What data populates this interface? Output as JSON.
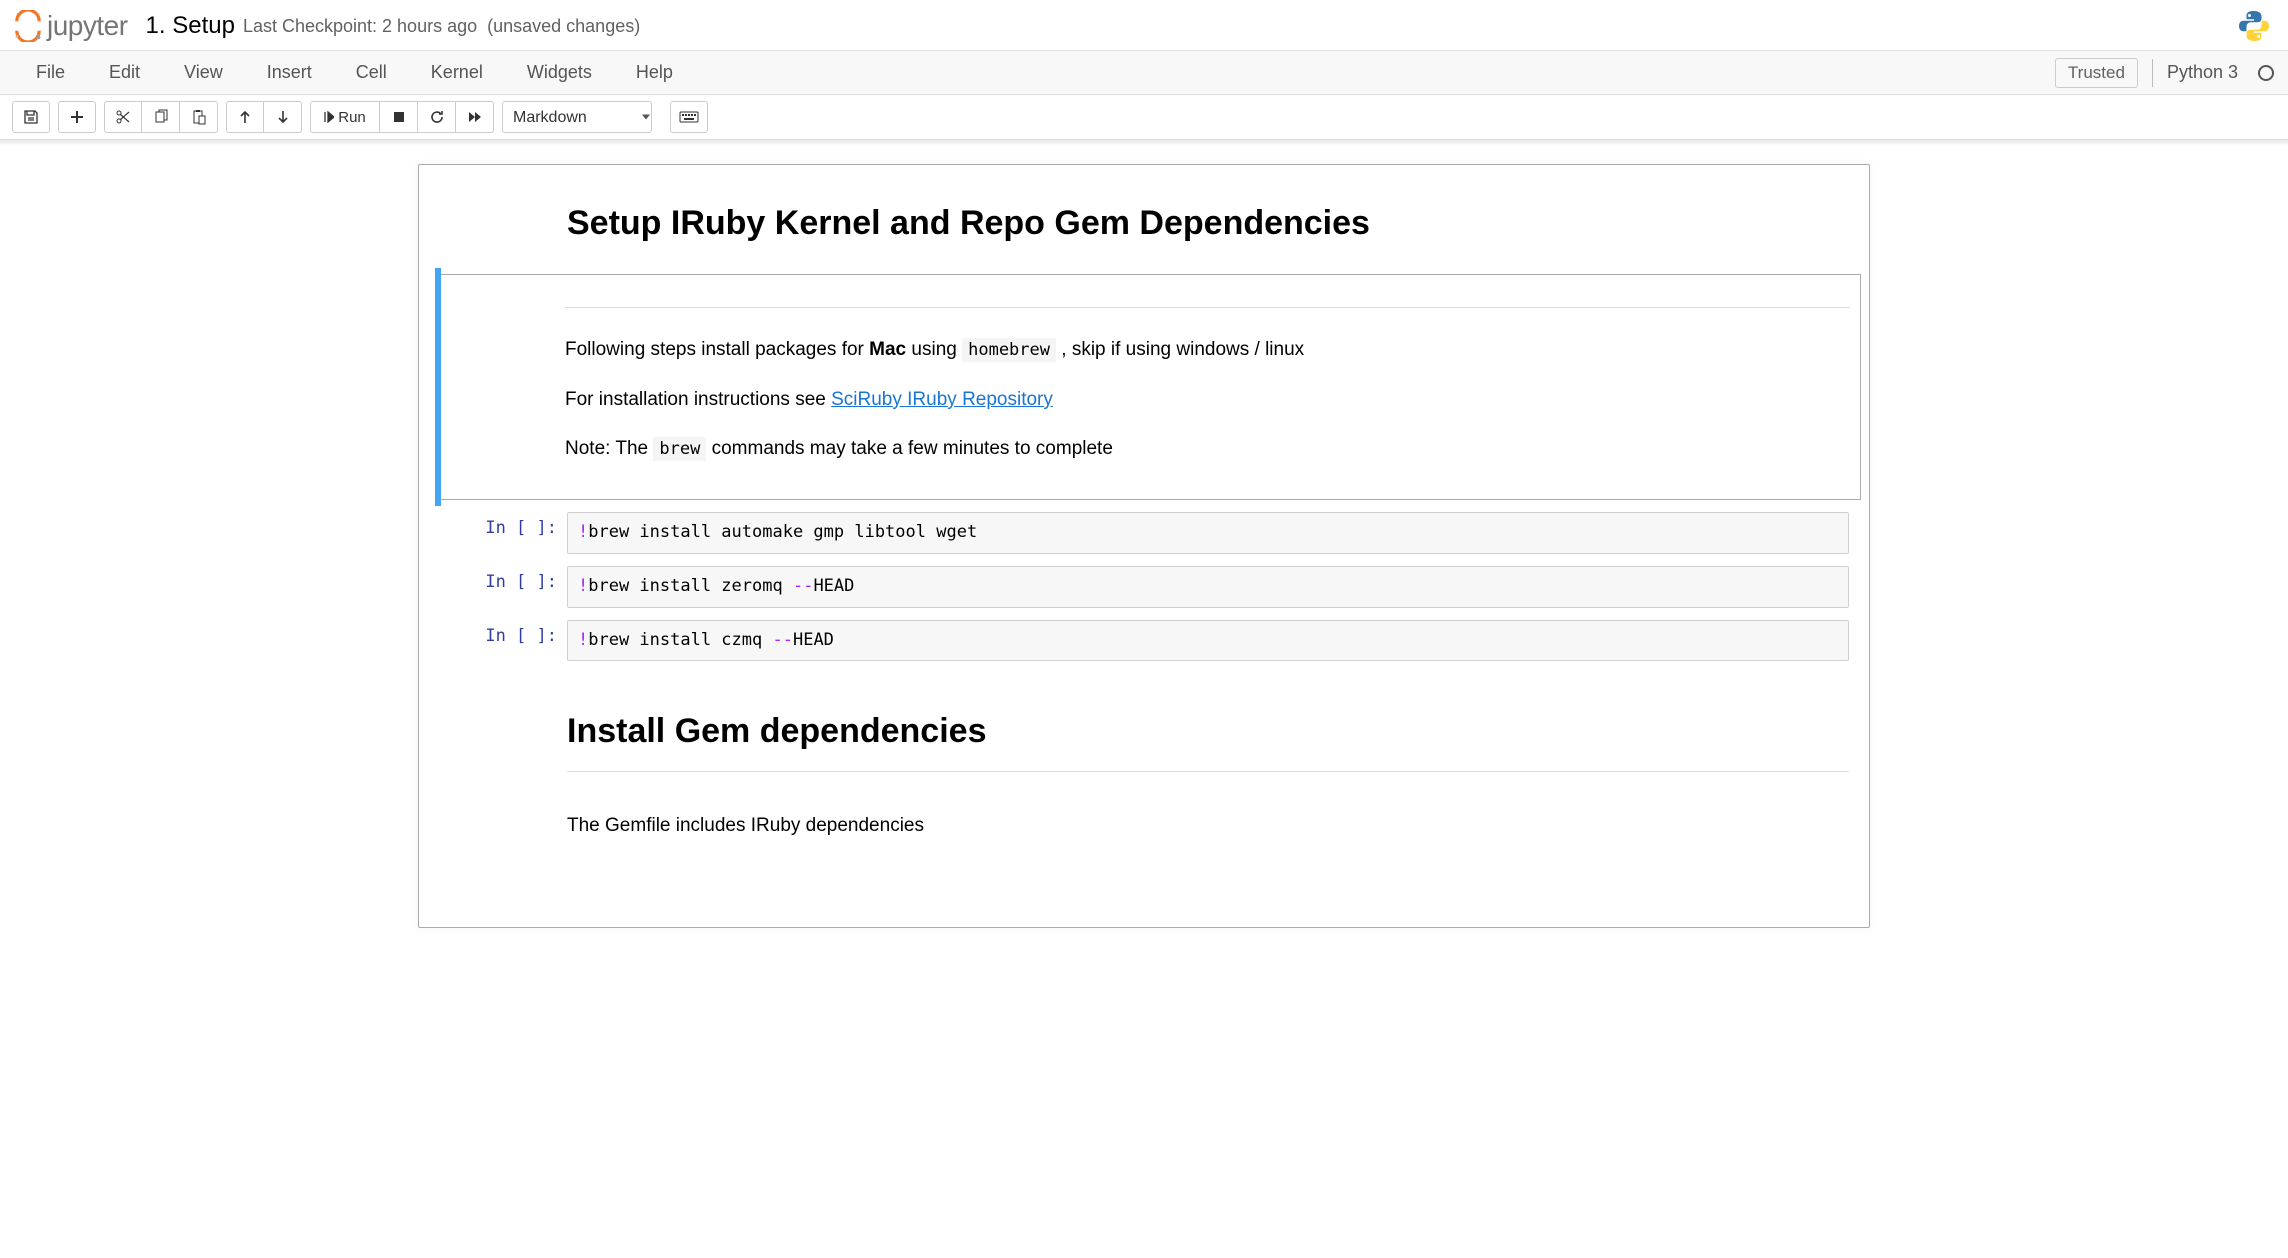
{
  "header": {
    "logo_text": "jupyter",
    "notebook_name": "1. Setup",
    "checkpoint": "Last Checkpoint: 2 hours ago",
    "unsaved": "(unsaved changes)"
  },
  "menubar": {
    "items": [
      "File",
      "Edit",
      "View",
      "Insert",
      "Cell",
      "Kernel",
      "Widgets",
      "Help"
    ],
    "trusted": "Trusted",
    "kernel": "Python 3"
  },
  "toolbar": {
    "run_label": "Run",
    "celltype": "Markdown"
  },
  "cells": {
    "md1": {
      "heading": "Setup IRuby Kernel and Repo Gem Dependencies"
    },
    "md2": {
      "p1_pre": "Following steps install packages for ",
      "p1_bold": "Mac",
      "p1_mid": " using ",
      "p1_code": "homebrew",
      "p1_post": " , skip if using windows / linux",
      "p2_pre": "For installation instructions see ",
      "p2_link": "SciRuby IRuby Repository",
      "p3_pre": "Note: The ",
      "p3_code": "brew",
      "p3_post": " commands may take a few minutes to complete"
    },
    "code1": {
      "prompt": "In [ ]:",
      "bang": "!",
      "cmd": "brew install automake gmp libtool wget"
    },
    "code2": {
      "prompt": "In [ ]:",
      "bang": "!",
      "cmd1": "brew install zeromq ",
      "op": "--",
      "cmd2": "HEAD"
    },
    "code3": {
      "prompt": "In [ ]:",
      "bang": "!",
      "cmd1": "brew install czmq ",
      "op": "--",
      "cmd2": "HEAD"
    },
    "md3": {
      "heading": "Install Gem dependencies",
      "p1": "The Gemfile includes IRuby dependencies"
    }
  }
}
